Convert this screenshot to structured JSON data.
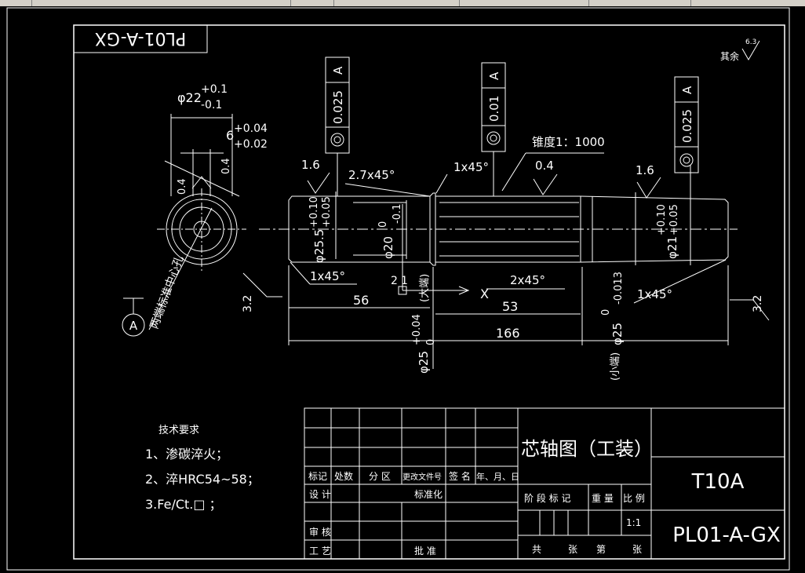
{
  "drawing_code": "PL01-A-GX",
  "material": "T10A",
  "title": "芯轴图（工装）",
  "roughness": {
    "label": "其余",
    "value": "6.3",
    "left_value": "3.2",
    "right_value": "3.2",
    "r1": "1.6",
    "r2": "0.4",
    "r3": "1.6"
  },
  "tolerance_frames": [
    {
      "value": "0.025",
      "datum": "A"
    },
    {
      "value": "0.01",
      "datum": "A"
    },
    {
      "value": "0.025",
      "datum": "A"
    }
  ],
  "datum_label": "A",
  "end_view": {
    "dia": "φ22",
    "dia_tol_upper": "+0.1",
    "dia_tol_lower": "-0.1",
    "keyway": "6",
    "keyway_upper": "+0.04",
    "keyway_lower": "+0.02",
    "r_left": "0.4",
    "r_right": "0.4",
    "note": "两端标准中心孔"
  },
  "shaft": {
    "taper_label": "锥度1：1000",
    "chamfer_2_7": "2.7x45°",
    "chamfer_1_top": "1x45°",
    "chamfer_1_left": "1x45°",
    "chamfer_2": "2x45°",
    "chamfer_1_right": "1x45°",
    "d255": "φ25.5",
    "d255_upper": "+0.10",
    "d255_lower": "+0.05",
    "d20": "φ20",
    "d20_upper": "0",
    "d20_lower": "-0.1",
    "d21": "φ21",
    "d21_upper": "+0.10",
    "d21_lower": "+0.05",
    "d25_big": "φ25",
    "d25_big_upper": "+0.04",
    "d25_big_lower": "0",
    "big_end": "(大端)",
    "d25_small": "φ25",
    "d25_small_upper": "0",
    "d25_small_lower": "-0.013",
    "small_end": "(小端)",
    "len56": "56",
    "len53": "53",
    "len166": "166",
    "len2": "2",
    "len1": "1",
    "axis_x": "X"
  },
  "tech_requirements": {
    "title": "技术要求",
    "items": [
      "1、渗碳淬火；",
      "2、淬HRC54~58；",
      "3.Fe/Ct.□ ；"
    ]
  },
  "title_block": {
    "hdr": [
      "标记",
      "处数",
      "分 区",
      "更改文件号",
      "签 名",
      "年、月、日"
    ],
    "design": "设 计",
    "standardize": "标准化",
    "review": "审 核",
    "process": "工 艺",
    "approve": "批 准",
    "stage_mark": "阶 段 标 记",
    "weight": "重 量",
    "scale_label": "比 例",
    "scale": "1:1",
    "sheets": "共",
    "sheet_unit": "张",
    "page": "第",
    "page_unit": "张"
  }
}
